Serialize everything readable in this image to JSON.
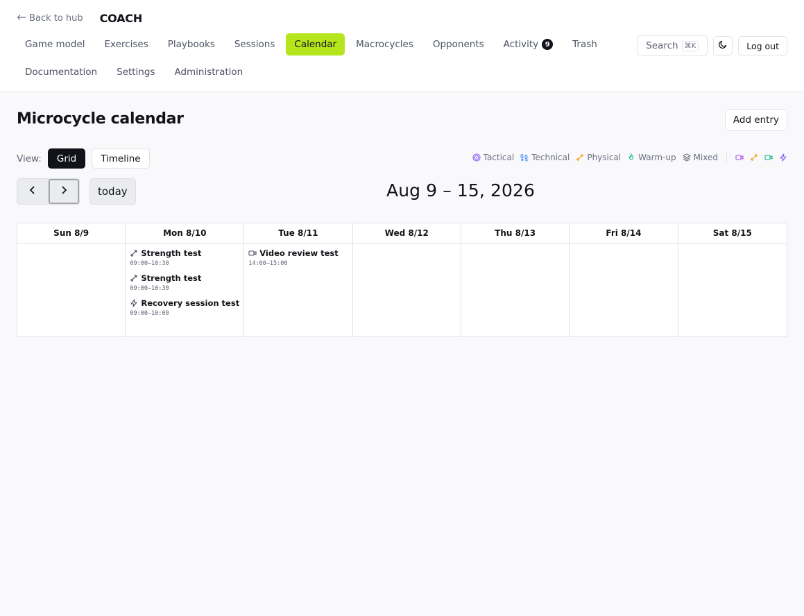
{
  "header": {
    "back_label": "Back to hub",
    "brand": "COACH",
    "nav": [
      {
        "label": "Game model"
      },
      {
        "label": "Exercises"
      },
      {
        "label": "Playbooks"
      },
      {
        "label": "Sessions"
      },
      {
        "label": "Calendar"
      },
      {
        "label": "Macrocycles"
      },
      {
        "label": "Opponents"
      },
      {
        "label": "Activity",
        "badge": "9"
      },
      {
        "label": "Trash"
      },
      {
        "label": "Documentation"
      },
      {
        "label": "Settings"
      },
      {
        "label": "Administration"
      }
    ],
    "active_nav": "Calendar",
    "search_label": "Search",
    "search_shortcut": "⌘K",
    "logout_label": "Log out"
  },
  "page": {
    "title": "Microcycle calendar",
    "add_entry_label": "Add entry",
    "view_label": "View:",
    "views": [
      "Grid",
      "Timeline"
    ],
    "active_view": "Grid",
    "today_label": "today",
    "range_title": "Aug 9 – 15, 2026"
  },
  "legend": [
    {
      "label": "Tactical",
      "icon": "target-icon",
      "color": "#8b5cf6"
    },
    {
      "label": "Technical",
      "icon": "footprints-icon",
      "color": "#3b82f6"
    },
    {
      "label": "Physical",
      "icon": "dumbbell-icon",
      "color": "#f59e0b"
    },
    {
      "label": "Warm-up",
      "icon": "flame-icon",
      "color": "#10b981"
    },
    {
      "label": "Mixed",
      "icon": "layers-icon",
      "color": "#6b7080"
    }
  ],
  "legend_icons": [
    {
      "icon": "video-icon",
      "color": "#a855f7"
    },
    {
      "icon": "dumbbell-icon",
      "color": "#f59e0b"
    },
    {
      "icon": "video-icon",
      "color": "#10b981"
    },
    {
      "icon": "zap-icon",
      "color": "#8b5cf6"
    }
  ],
  "calendar": {
    "days": [
      {
        "label": "Sun 8/9",
        "events": []
      },
      {
        "label": "Mon 8/10",
        "events": [
          {
            "title": "Strength test",
            "time": "09:00–10:30",
            "icon": "dumbbell-icon"
          },
          {
            "title": "Strength test",
            "time": "09:00–10:30",
            "icon": "dumbbell-icon"
          },
          {
            "title": "Recovery session test",
            "time": "09:00–10:00",
            "icon": "zap-icon"
          }
        ]
      },
      {
        "label": "Tue 8/11",
        "events": [
          {
            "title": "Video review test",
            "time": "14:00–15:00",
            "icon": "video-icon"
          }
        ]
      },
      {
        "label": "Wed 8/12",
        "events": []
      },
      {
        "label": "Thu 8/13",
        "events": []
      },
      {
        "label": "Fri 8/14",
        "events": []
      },
      {
        "label": "Sat 8/15",
        "events": []
      }
    ]
  }
}
